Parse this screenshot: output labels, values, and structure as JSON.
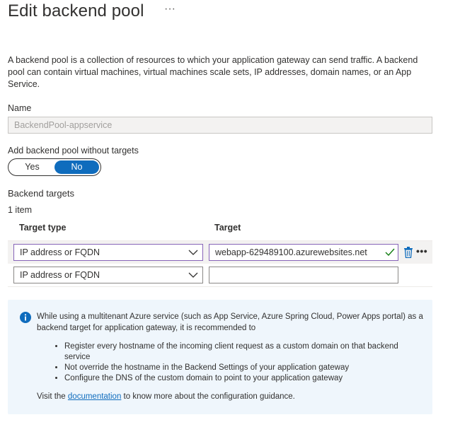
{
  "page": {
    "title": "Edit backend pool",
    "more_label": "···",
    "description": "A backend pool is a collection of resources to which your application gateway can send traffic. A backend pool can contain virtual machines, virtual machines scale sets, IP addresses, domain names, or an App Service."
  },
  "name_field": {
    "label": "Name",
    "value": "BackendPool-appservice"
  },
  "without_targets": {
    "label": "Add backend pool without targets",
    "yes_label": "Yes",
    "no_label": "No",
    "selected": "No"
  },
  "backend_targets": {
    "label": "Backend targets",
    "count": "1 item",
    "col_type": "Target type",
    "col_target": "Target",
    "rows": [
      {
        "type": "IP address or FQDN",
        "target": "webapp-629489100.azurewebsites.net",
        "valid": true
      },
      {
        "type": "IP address or FQDN",
        "target": ""
      }
    ],
    "row_more": "•••"
  },
  "info": {
    "text": "While using a multitenant Azure service (such as App Service, Azure Spring Cloud, Power Apps portal) as a backend target for application gateway, it is recommended to",
    "bullets": [
      "Register every hostname of the incoming client request as a custom domain on that backend service",
      "Not override the hostname in the Backend Settings of your application gateway",
      "Configure the DNS of the custom domain to point to your application gateway"
    ],
    "visit_prefix": "Visit the ",
    "link_text": "documentation",
    "visit_suffix": " to know more about the configuration guidance."
  },
  "colors": {
    "accent": "#0f6cbd",
    "valid_check": "#107c10",
    "focus_border": "#8764b8",
    "info_bg": "#eff6fc"
  }
}
